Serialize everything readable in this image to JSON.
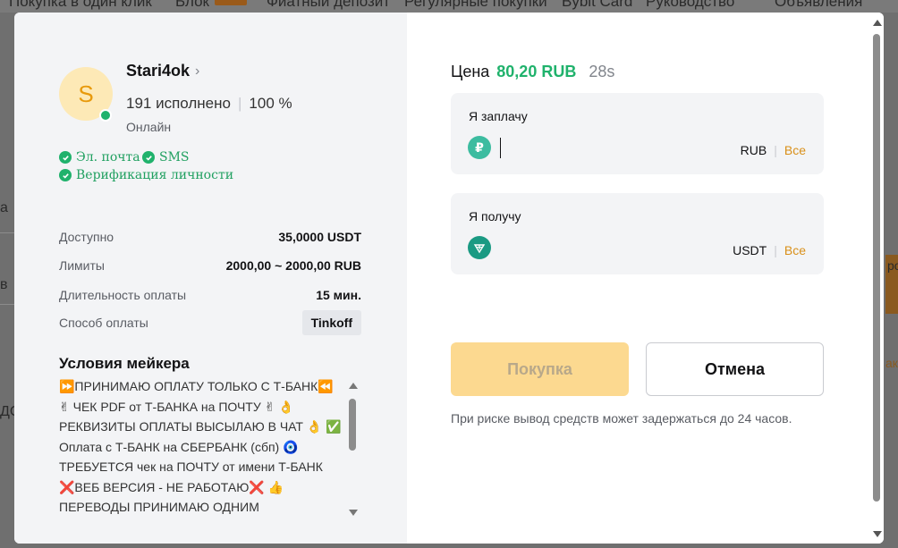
{
  "background": {
    "nav_items": [
      "Покупка в один клик",
      "Блок",
      "Фиатный депозит",
      "Регулярные покупки",
      "Bybit Card",
      "Руководство",
      "Объявления"
    ],
    "fragments": [
      "а",
      "в",
      "ДС",
      "ро",
      "ак"
    ]
  },
  "seller": {
    "avatar_letter": "S",
    "name": "Stari4ok",
    "orders_completed": "191 исполнено",
    "completion_rate": "100 %",
    "status": "Онлайн",
    "verifications": [
      "Эл. почта",
      "SMS",
      "Верификация личности"
    ]
  },
  "details": {
    "available_label": "Доступно",
    "available_value": "35,0000 USDT",
    "limits_label": "Лимиты",
    "limits_value": "2000,00 ~ 2000,00 RUB",
    "duration_label": "Длительность оплаты",
    "duration_value": "15 мин.",
    "method_label": "Способ оплаты",
    "method_value": "Tinkoff"
  },
  "terms": {
    "title": "Условия мейкера",
    "text": "⏩ПРИНИМАЮ ОПЛАТУ ТОЛЬКО С Т-БАНК⏪ ✌ ЧЕК PDF от Т-БАНКА на ПОЧТУ ✌ 👌 РЕКВИЗИТЫ ОПЛАТЫ ВЫСЫЛАЮ В ЧАТ 👌 ✅ Оплата с Т-БАНК на СБЕРБАНК (сбп) 🧿 ТРЕБУЕТСЯ чек на ПОЧТУ от имени Т-БАНК ❌ВЕБ ВЕРСИЯ - НЕ РАБОТАЮ❌ 👍 ПЕРЕВОДЫ ПРИНИМАЮ ОДНИМ"
  },
  "trade": {
    "price_label": "Цена",
    "price_value": "80,20 RUB",
    "timer": "28s",
    "pay_label": "Я заплачу",
    "pay_currency": "RUB",
    "pay_all": "Все",
    "pay_coin_symbol": "₽",
    "receive_label": "Я получу",
    "receive_currency": "USDT",
    "receive_all": "Все",
    "buy_button": "Покупка",
    "cancel_button": "Отмена",
    "risk_note": "При риске вывод средств может задержаться до 24 часов."
  },
  "colors": {
    "accent_green": "#20b26c",
    "buy_button_disabled": "#fcd990",
    "all_link": "#d9901a"
  }
}
